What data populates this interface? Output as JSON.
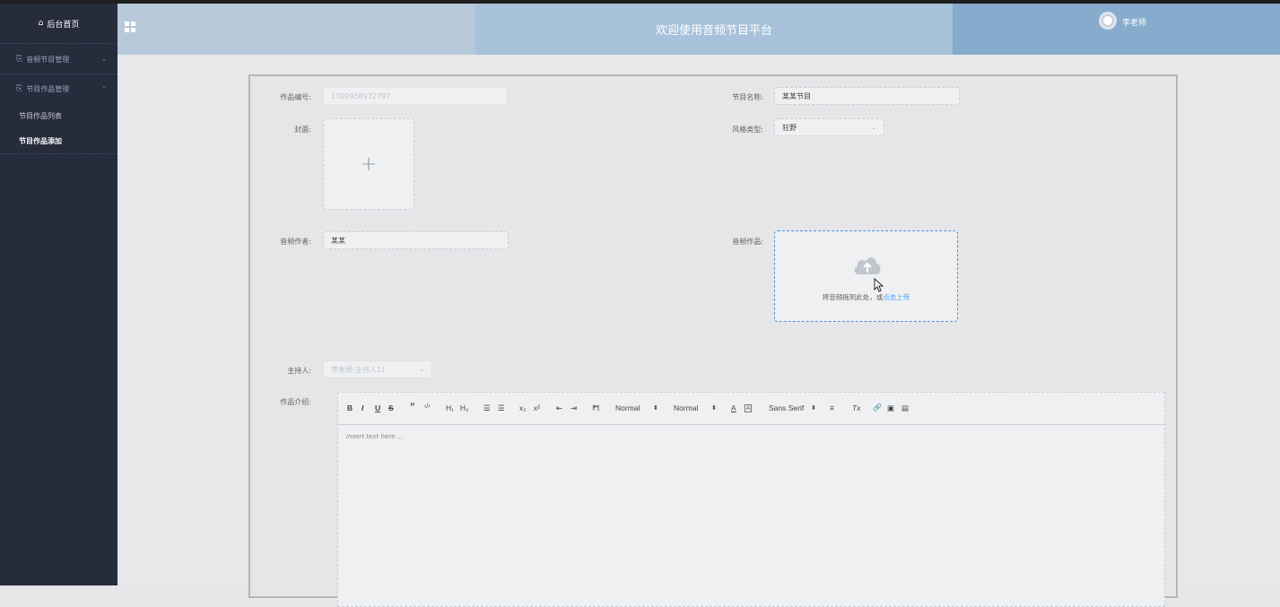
{
  "sidebar": {
    "home_label": "后台首页",
    "menus": [
      {
        "label": "音频节目管理",
        "chevron": "⌄"
      },
      {
        "label": "节目作品管理",
        "chevron": "⌃"
      }
    ],
    "subitems": [
      {
        "label": "节目作品列表"
      },
      {
        "label": "节目作品添加"
      }
    ]
  },
  "header": {
    "title": "欢迎使用音频节目平台",
    "user": "李老师"
  },
  "form": {
    "id_label": "作品编号:",
    "id_value": "1709958972797",
    "name_label": "节目名称:",
    "name_value": "某某节目",
    "cover_label": "封面:",
    "cover_plus": "+",
    "style_label": "风格类型:",
    "style_value": "狂野",
    "author_label": "音频作者:",
    "author_value": "某某",
    "work_label": "音频作品:",
    "upload_text": "将音频拖到此处，或",
    "upload_link": "点击上传",
    "host_label": "主持人:",
    "host_value": "李老师-主持人11",
    "intro_label": "作品介绍:"
  },
  "editor": {
    "toolbar": {
      "bold": "B",
      "italic": "I",
      "underline": "U",
      "strike": "S",
      "quote": "”",
      "code": "‹/›",
      "h1": "H₁",
      "h2": "H₂",
      "ol": "☰",
      "ul": "☰",
      "sub": "x₂",
      "sup": "x²",
      "outdent": "⇤",
      "indent": "⇥",
      "direction": "⁋¶",
      "size": "Normal",
      "header": "Normal",
      "color": "A",
      "background": "A",
      "font": "Sans Serif",
      "align": "≡",
      "clean": "Tx",
      "link": "🔗",
      "image": "▣",
      "video": "▤"
    },
    "placeholder": "Insert text here ..."
  },
  "colors": {
    "sidebar_bg": "#272c3d",
    "header_left": "#b7c9d9",
    "header_mid": "#a7c2da",
    "header_right": "#86abcd",
    "link": "#409eff"
  }
}
